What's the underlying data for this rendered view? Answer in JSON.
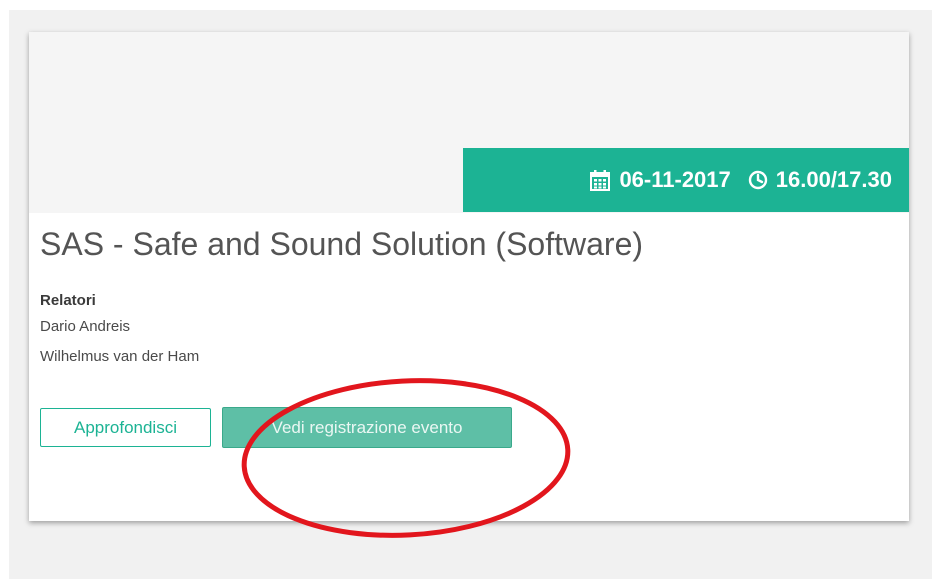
{
  "colors": {
    "accent": "#1cb394",
    "filled_button": "#5ebfa6",
    "annotation": "#e2161d"
  },
  "event": {
    "date": "06-11-2017",
    "time": "16.00/17.30",
    "date_icon": "calendar-icon",
    "time_icon": "clock-icon",
    "title": "SAS - Safe and Sound Solution (Software)"
  },
  "speakers": {
    "heading": "Relatori",
    "names": [
      "Dario Andreis",
      "Wilhelmus van der Ham"
    ]
  },
  "actions": {
    "details_label": "Approfondisci",
    "recording_label": "Vedi registrazione evento"
  }
}
